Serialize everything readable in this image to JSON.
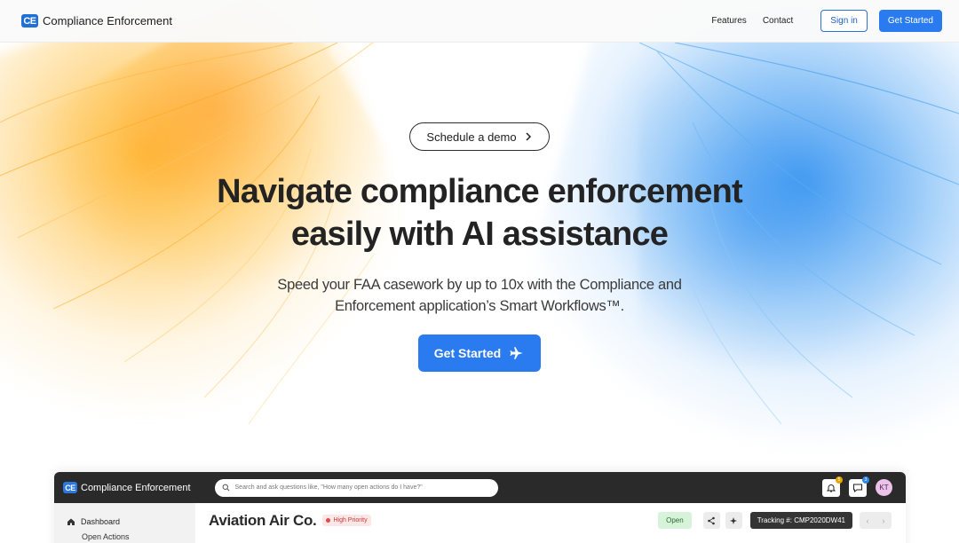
{
  "header": {
    "logo_badge": "CE",
    "logo_text": "Compliance Enforcement",
    "nav": {
      "features": "Features",
      "contact": "Contact",
      "signin": "Sign in",
      "get_started": "Get Started"
    }
  },
  "hero": {
    "demo_pill": "Schedule a demo",
    "headline_line1": "Navigate compliance enforcement",
    "headline_line2": "easily with AI assistance",
    "subline_line1": "Speed your FAA casework by up to 10x with the Compliance and",
    "subline_line2": "Enforcement application’s Smart Workflows™.",
    "cta": "Get Started"
  },
  "preview": {
    "logo_badge": "CE",
    "logo_text": "Compliance Enforcement",
    "search_placeholder": "Search and ask questions like, \"How many open actions do I have?\"",
    "notification_count": "5",
    "message_count": "3",
    "avatar_initials": "KT",
    "sidebar": {
      "dashboard": "Dashboard",
      "open_actions": "Open Actions"
    },
    "company": "Aviation Air Co.",
    "priority": "High Priority",
    "status": "Open",
    "tracking": "Tracking #: CMP2020DW41",
    "pager_prev": "‹",
    "pager_next": "›"
  },
  "colors": {
    "brand_blue": "#2b7bf0",
    "dark_bar": "#2a2a2a",
    "status_green": "#d7f3d9",
    "priority_red": "#c23b3b"
  },
  "icons": [
    "chevron-right-icon",
    "airplane-icon",
    "search-icon",
    "bell-icon",
    "chat-icon",
    "home-icon",
    "share-icon",
    "sparkle-icon"
  ]
}
